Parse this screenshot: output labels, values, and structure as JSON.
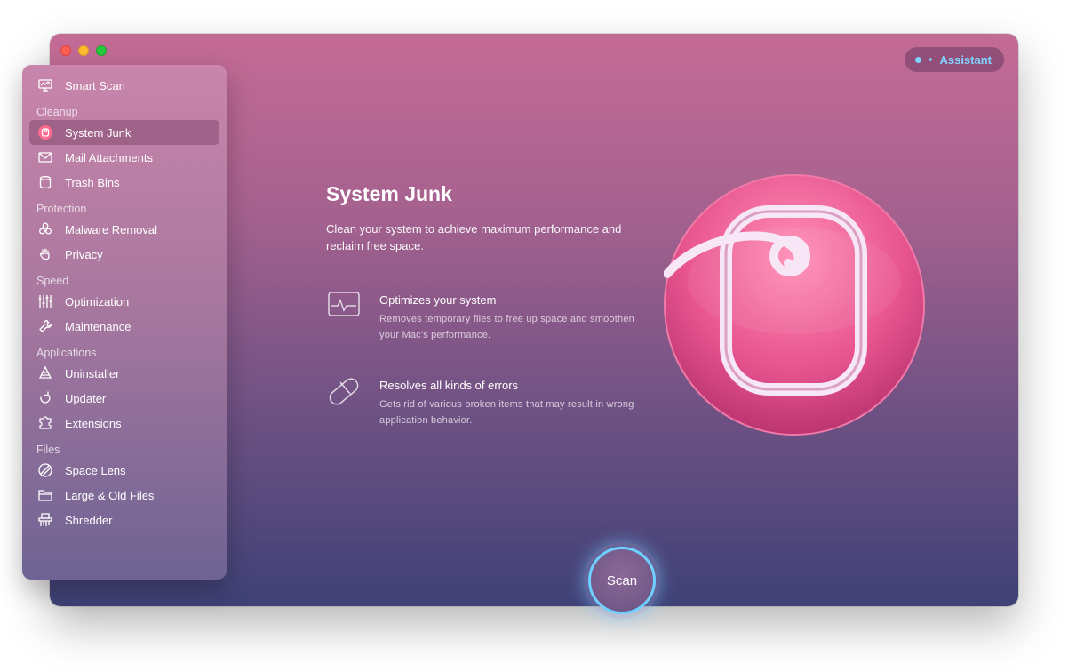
{
  "assistant": {
    "label": "Assistant"
  },
  "sidebar": {
    "items": [
      {
        "label": "Smart Scan"
      },
      {
        "section": "Cleanup"
      },
      {
        "label": "System Junk"
      },
      {
        "label": "Mail Attachments"
      },
      {
        "label": "Trash Bins"
      },
      {
        "section": "Protection"
      },
      {
        "label": "Malware Removal"
      },
      {
        "label": "Privacy"
      },
      {
        "section": "Speed"
      },
      {
        "label": "Optimization"
      },
      {
        "label": "Maintenance"
      },
      {
        "section": "Applications"
      },
      {
        "label": "Uninstaller"
      },
      {
        "label": "Updater"
      },
      {
        "label": "Extensions"
      },
      {
        "section": "Files"
      },
      {
        "label": "Space Lens"
      },
      {
        "label": "Large & Old Files"
      },
      {
        "label": "Shredder"
      }
    ],
    "active": "System Junk"
  },
  "main": {
    "title": "System Junk",
    "description": "Clean your system to achieve maximum performance and reclaim free space.",
    "features": [
      {
        "title": "Optimizes your system",
        "description": "Removes temporary files to free up space and smoothen your Mac's performance.",
        "icon": "monitor-graph-icon"
      },
      {
        "title": "Resolves all kinds of errors",
        "description": "Gets rid of various broken items that may result in wrong application behavior.",
        "icon": "pill-icon"
      }
    ]
  },
  "scan": {
    "label": "Scan"
  },
  "colors": {
    "accent": "#6fd0ff",
    "hero": "#e8558f",
    "assistant": "#7fd3ff"
  }
}
